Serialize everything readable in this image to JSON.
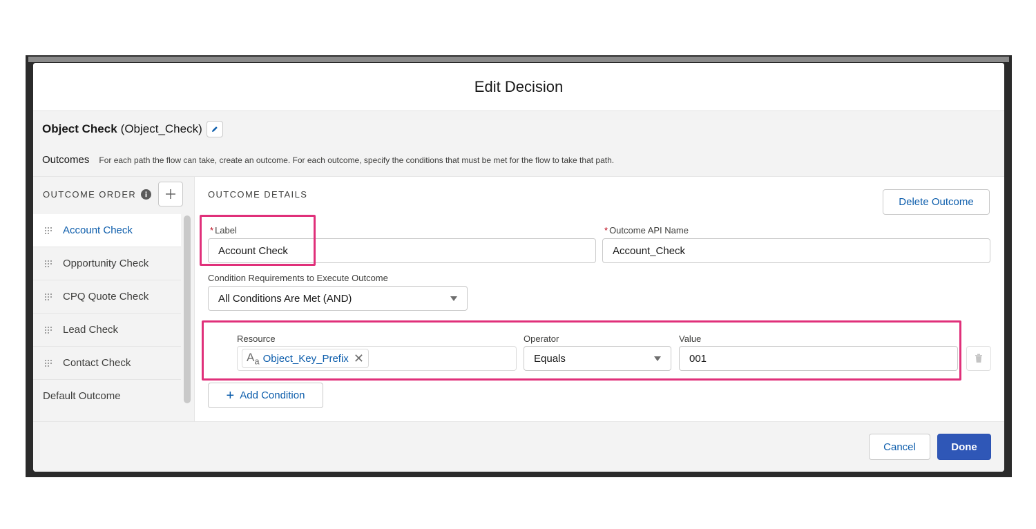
{
  "modal": {
    "title": "Edit Decision"
  },
  "element": {
    "name": "Object Check",
    "api_name": "(Object_Check)"
  },
  "outcomes": {
    "title": "Outcomes",
    "description": "For each path the flow can take, create an outcome. For each outcome, specify the conditions that must be met for the flow to take that path."
  },
  "sidebar": {
    "order_label": "OUTCOME ORDER",
    "items": [
      {
        "label": "Account Check",
        "active": true
      },
      {
        "label": "Opportunity Check",
        "active": false
      },
      {
        "label": "CPQ Quote Check",
        "active": false
      },
      {
        "label": "Lead Check",
        "active": false
      },
      {
        "label": "Contact Check",
        "active": false
      }
    ],
    "default_outcome": "Default Outcome"
  },
  "details": {
    "section_label": "OUTCOME DETAILS",
    "delete_label": "Delete Outcome",
    "label_field": {
      "required": "*",
      "label": "Label",
      "value": "Account Check"
    },
    "api_field": {
      "required": "*",
      "label": "Outcome API Name",
      "value": "Account_Check"
    },
    "requirement": {
      "label": "Condition Requirements to Execute Outcome",
      "value": "All Conditions Are Met (AND)"
    },
    "condition": {
      "resource_label": "Resource",
      "resource_icon": "A",
      "resource_icon_sub": "a",
      "resource_value": "Object_Key_Prefix",
      "operator_label": "Operator",
      "operator_value": "Equals",
      "value_label": "Value",
      "value_value": "001"
    },
    "add_condition_label": "Add Condition"
  },
  "footer": {
    "cancel_label": "Cancel",
    "done_label": "Done"
  },
  "colors": {
    "accent": "#0b5cab",
    "brand_button": "#2f57b7",
    "highlight": "#e0307a",
    "required": "#ba0517"
  }
}
